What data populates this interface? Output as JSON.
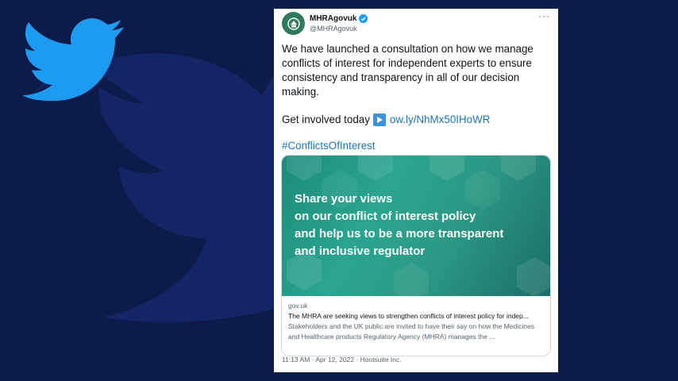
{
  "tweet": {
    "display_name": "MHRAgovuk",
    "handle": "@MHRAgovuk",
    "more": "···",
    "body": "We have launched a consultation on how we manage conflicts of interest for independent experts to ensure consistency and transparency in all of our decision making.",
    "cta_text": "Get involved today",
    "link_text": "ow.ly/NhMx50IHoWR",
    "hashtag": "#ConflictsOfInterest",
    "card": {
      "headline_lines": [
        "Share your views",
        "on our conflict of interest policy",
        "and help us to be a more transparent",
        "and inclusive regulator"
      ],
      "domain": "gov.uk",
      "title": "The MHRA are seeking views to strengthen conflicts of interest policy for indep...",
      "description": "Stakeholders and the UK public are invited to have their say on how the Medicines and Healthcare products Regulatory Agency (MHRA) manages the ..."
    },
    "timestamp": "11:13 AM · Apr 12, 2022 · Hootsuite Inc."
  },
  "colors": {
    "background": "#0d1b4a",
    "twitter_blue": "#1d9bf0",
    "link": "#1d74b5",
    "card_teal": "#2aa58f"
  },
  "icons": [
    "twitter-bird-icon",
    "verified-badge-icon",
    "play-arrow-icon",
    "more-options-icon",
    "crest-icon"
  ]
}
